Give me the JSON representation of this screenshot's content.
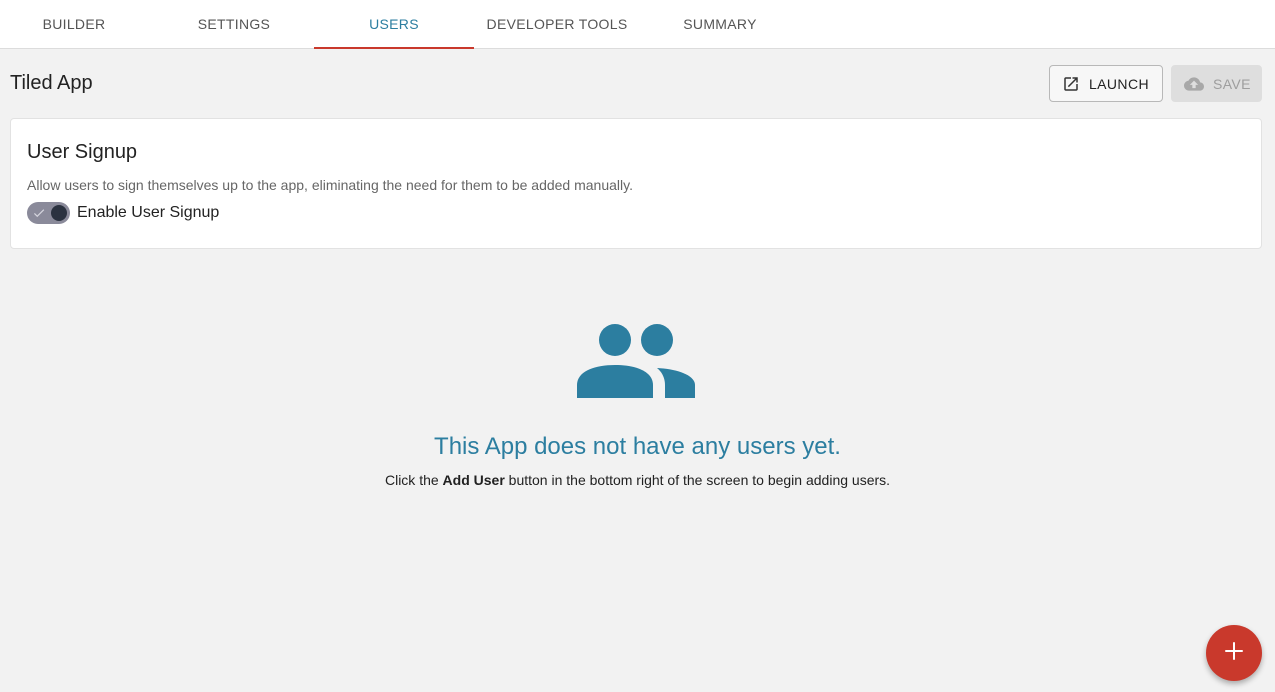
{
  "tabs": [
    {
      "label": "BUILDER",
      "active": false
    },
    {
      "label": "SETTINGS",
      "active": false
    },
    {
      "label": "USERS",
      "active": true
    },
    {
      "label": "DEVELOPER TOOLS",
      "active": false
    },
    {
      "label": "SUMMARY",
      "active": false
    }
  ],
  "header": {
    "title": "Tiled App",
    "launch_label": "LAUNCH",
    "launch_icon": "open-in-new-icon",
    "save_label": "SAVE",
    "save_icon": "cloud-upload-icon",
    "save_disabled": true
  },
  "signup": {
    "title": "User Signup",
    "description": "Allow users to sign themselves up to the app, eliminating the need for them to be added manually.",
    "toggle_label": "Enable User Signup",
    "toggle_on": true
  },
  "empty_state": {
    "icon": "people-icon",
    "title": "This App does not have any users yet.",
    "sub_before": "Click the ",
    "sub_bold": "Add User",
    "sub_after": " button in the bottom right of the screen to begin adding users."
  },
  "fab": {
    "icon": "plus-icon"
  },
  "colors": {
    "accent": "#2c7ea0",
    "primary_red": "#c9392c",
    "background": "#f2f2f2"
  }
}
